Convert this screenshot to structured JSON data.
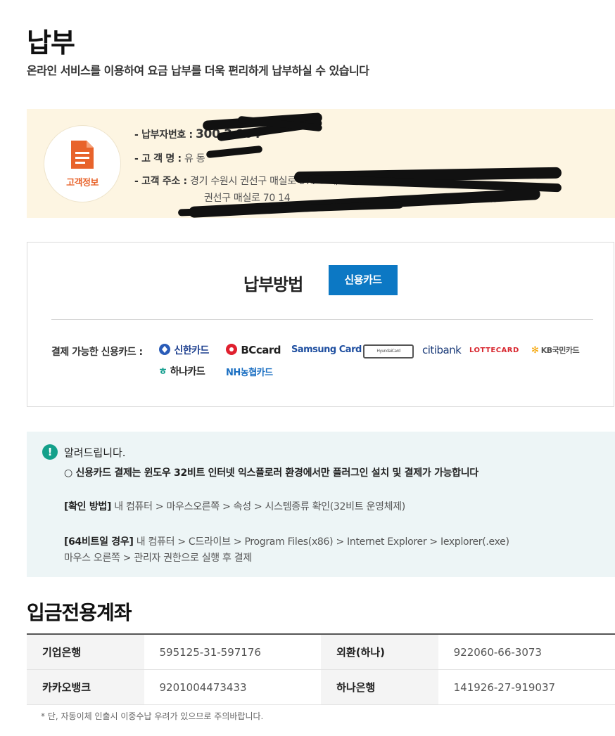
{
  "page": {
    "title": "납부",
    "subtitle": "온라인 서비스를 이용하여 요금 납부를 더욱 편리하게 납부하실 수 있습니다"
  },
  "customer": {
    "badge_label": "고객정보",
    "payer_no_label": "- 납부자번호 :",
    "payer_no_value": "300 2 964",
    "name_label": "- 고  객  명 :",
    "name_value": "유 동",
    "address_label": "- 고객  주소 :",
    "address_line1": "경기 수원시 권선구 매실로 377 호매",
    "address_line2": "권선구 매실로 70 14",
    "address_line2_tail": "))"
  },
  "payment": {
    "title": "납부방법",
    "method_button": "신용카드",
    "cards_label": "결제 가능한 신용카드 :",
    "cards": [
      {
        "name": "신한카드",
        "icon": "shinhan-logo-icon",
        "color": "#1d3f8f"
      },
      {
        "name": "BCcard",
        "icon": "bc-logo-icon",
        "color": "#222222"
      },
      {
        "name": "Samsung Card",
        "icon": "samsung-logo-icon",
        "color": "#1f4fa0"
      },
      {
        "name": "HyundaiCard",
        "icon": "hyundai-logo-icon",
        "color": "#555555"
      },
      {
        "name": "citibank",
        "icon": "citi-logo-icon",
        "color": "#1a3a78"
      },
      {
        "name": "LOTTECARD",
        "icon": "lotte-logo-icon",
        "color": "#d8262e"
      },
      {
        "name": "KB국민카드",
        "icon": "kb-logo-icon",
        "color": "#555555"
      },
      {
        "name": "하나카드",
        "icon": "hana-logo-icon",
        "color": "#222222"
      },
      {
        "name": "NH농협카드",
        "icon": "nh-logo-icon",
        "color": "#1b6fc2"
      }
    ]
  },
  "notice": {
    "title": "알려드립니다.",
    "line1": "○ 신용카드 결제는 윈도우 32비트 인터넷 익스플로러 환경에서만 플러그인 설치 및 결제가 가능합니다",
    "check_label": "[확인 방법]",
    "check_text": "내 컴퓨터 > 마우스오른쪽 > 속성 > 시스템종류 확인(32비트 운영체제)",
    "x64_label": "[64비트일 경우]",
    "x64_text": "내 컴퓨터 > C드라이브 > Program Files(x86) > Internet Explorer > Iexplorer(.exe)",
    "x64_text2": "마우스 오른쪽 > 관리자 권한으로 실행 후 결제"
  },
  "accounts": {
    "title": "입금전용계좌",
    "rows": [
      [
        {
          "bank": "기업은행",
          "number": "595125-31-597176"
        },
        {
          "bank": "외환(하나)",
          "number": "922060-66-3073"
        }
      ],
      [
        {
          "bank": "카카오뱅크",
          "number": "9201004473433"
        },
        {
          "bank": "하나은행",
          "number": "141926-27-919037"
        }
      ]
    ],
    "footnote": "* 단, 자동이체 인출시 이중수납 우려가 있으므로 주의바랍니다."
  },
  "colors": {
    "accent_blue": "#0c78c4",
    "customer_bg": "#fdf5e2",
    "notice_bg": "#edf5f6",
    "notice_icon": "#13a08a",
    "badge_orange": "#e8632b"
  }
}
